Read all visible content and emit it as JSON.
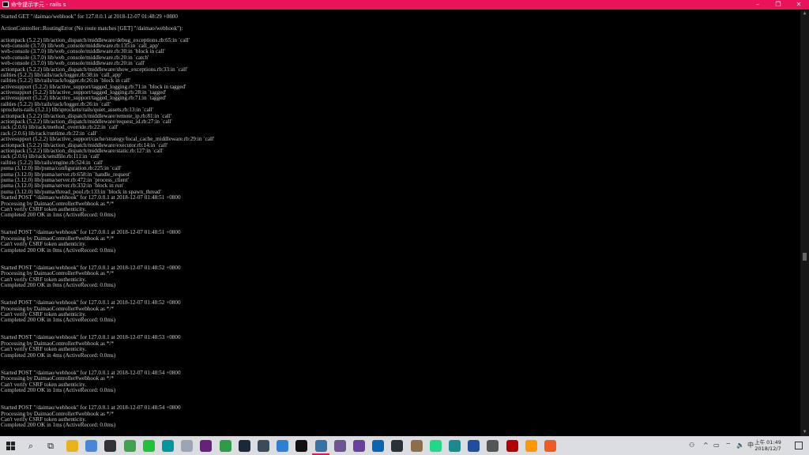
{
  "window": {
    "title": "命令提示字元 - rails  s",
    "minimize": "–",
    "maximize": "❐",
    "close": "✕"
  },
  "console_lines": [
    "Started GET \"/daimao/webhook\" for 127.0.0.1 at 2018-12-07 01:48:29 +0800",
    "",
    "ActionController::RoutingError (No route matches [GET] \"/daimao/webhook\"):",
    "",
    "actionpack (5.2.2) lib/action_dispatch/middleware/debug_exceptions.rb:65:in `call'",
    "web-console (3.7.0) lib/web_console/middleware.rb:135:in `call_app'",
    "web-console (3.7.0) lib/web_console/middleware.rb:30:in `block in call'",
    "web-console (3.7.0) lib/web_console/middleware.rb:20:in `catch'",
    "web-console (3.7.0) lib/web_console/middleware.rb:20:in `call'",
    "actionpack (5.2.2) lib/action_dispatch/middleware/show_exceptions.rb:33:in `call'",
    "railties (5.2.2) lib/rails/rack/logger.rb:38:in `call_app'",
    "railties (5.2.2) lib/rails/rack/logger.rb:26:in `block in call'",
    "activesupport (5.2.2) lib/active_support/tagged_logging.rb:71:in `block in tagged'",
    "activesupport (5.2.2) lib/active_support/tagged_logging.rb:28:in `tagged'",
    "activesupport (5.2.2) lib/active_support/tagged_logging.rb:71:in `tagged'",
    "railties (5.2.2) lib/rails/rack/logger.rb:26:in `call'",
    "sprockets-rails (3.2.1) lib/sprockets/rails/quiet_assets.rb:13:in `call'",
    "actionpack (5.2.2) lib/action_dispatch/middleware/remote_ip.rb:81:in `call'",
    "actionpack (5.2.2) lib/action_dispatch/middleware/request_id.rb:27:in `call'",
    "rack (2.0.6) lib/rack/method_override.rb:22:in `call'",
    "rack (2.0.6) lib/rack/runtime.rb:22:in `call'",
    "activesupport (5.2.2) lib/active_support/cache/strategy/local_cache_middleware.rb:29:in `call'",
    "actionpack (5.2.2) lib/action_dispatch/middleware/executor.rb:14:in `call'",
    "actionpack (5.2.2) lib/action_dispatch/middleware/static.rb:127:in `call'",
    "rack (2.0.6) lib/rack/sendfile.rb:111:in `call'",
    "railties (5.2.2) lib/rails/engine.rb:524:in `call'",
    "puma (3.12.0) lib/puma/configuration.rb:225:in `call'",
    "puma (3.12.0) lib/puma/server.rb:658:in `handle_request'",
    "puma (3.12.0) lib/puma/server.rb:472:in `process_client'",
    "puma (3.12.0) lib/puma/server.rb:332:in `block in run'",
    "puma (3.12.0) lib/puma/thread_pool.rb:133:in `block in spawn_thread'",
    "Started POST \"/daimao/webhook\" for 127.0.0.1 at 2018-12-07 01:48:51 +0800",
    "Processing by DaimaoController#webhook as */*",
    "Can't verify CSRF token authenticity.",
    "Completed 200 OK in 1ms (ActiveRecord: 0.0ms)",
    "",
    "",
    "Started POST \"/daimao/webhook\" for 127.0.0.1 at 2018-12-07 01:48:51 +0800",
    "Processing by DaimaoController#webhook as */*",
    "Can't verify CSRF token authenticity.",
    "Completed 200 OK in 0ms (ActiveRecord: 0.0ms)",
    "",
    "",
    "Started POST \"/daimao/webhook\" for 127.0.0.1 at 2018-12-07 01:48:52 +0800",
    "Processing by DaimaoController#webhook as */*",
    "Can't verify CSRF token authenticity.",
    "Completed 200 OK in 0ms (ActiveRecord: 0.0ms)",
    "",
    "",
    "Started POST \"/daimao/webhook\" for 127.0.0.1 at 2018-12-07 01:48:52 +0800",
    "Processing by DaimaoController#webhook as */*",
    "Can't verify CSRF token authenticity.",
    "Completed 200 OK in 1ms (ActiveRecord: 0.0ms)",
    "",
    "",
    "Started POST \"/daimao/webhook\" for 127.0.0.1 at 2018-12-07 01:48:53 +0800",
    "Processing by DaimaoController#webhook as */*",
    "Can't verify CSRF token authenticity.",
    "Completed 200 OK in 4ms (ActiveRecord: 0.0ms)",
    "",
    "",
    "Started POST \"/daimao/webhook\" for 127.0.0.1 at 2018-12-07 01:48:54 +0800",
    "Processing by DaimaoController#webhook as */*",
    "Can't verify CSRF token authenticity.",
    "Completed 200 OK in 1ms (ActiveRecord: 0.0ms)",
    "",
    "",
    "Started POST \"/daimao/webhook\" for 127.0.0.1 at 2018-12-07 01:48:54 +0800",
    "Processing by DaimaoController#webhook as */*",
    "Can't verify CSRF token authenticity.",
    "Completed 200 OK in 1ms (ActiveRecord: 0.0ms)"
  ],
  "taskbar": {
    "clock_time": "上午 01:49",
    "clock_date": "2018/12/7",
    "ime": "中",
    "icons": [
      {
        "name": "file-explorer",
        "color": "#e8b21b"
      },
      {
        "name": "store",
        "color": "#4a86d8"
      },
      {
        "name": "media",
        "color": "#333333"
      },
      {
        "name": "chrome",
        "color": "#3fa34d"
      },
      {
        "name": "line",
        "color": "#1fc239"
      },
      {
        "name": "arduino",
        "color": "#00979d"
      },
      {
        "name": "photos",
        "color": "#9aa6b2"
      },
      {
        "name": "visual-studio",
        "color": "#68217a"
      },
      {
        "name": "git",
        "color": "#2e9c46"
      },
      {
        "name": "steam",
        "color": "#1b2838"
      },
      {
        "name": "server",
        "color": "#3c4b5c"
      },
      {
        "name": "mail",
        "color": "#2f7fd0"
      },
      {
        "name": "terminal",
        "color": "#111111"
      },
      {
        "name": "python",
        "color": "#3572a5"
      },
      {
        "name": "github",
        "color": "#6e5494"
      },
      {
        "name": "vs-code",
        "color": "#6b3fa0"
      },
      {
        "name": "app-blue",
        "color": "#0a64b4"
      },
      {
        "name": "app-dark",
        "color": "#263238"
      },
      {
        "name": "gimp",
        "color": "#8a6f4a"
      },
      {
        "name": "pycharm",
        "color": "#21d789"
      },
      {
        "name": "app-teal",
        "color": "#1a8a8a"
      },
      {
        "name": "app-navy",
        "color": "#1e4f9c"
      },
      {
        "name": "app-gray",
        "color": "#555555"
      },
      {
        "name": "filezilla",
        "color": "#b30000"
      },
      {
        "name": "sublime",
        "color": "#ff9800"
      },
      {
        "name": "postman",
        "color": "#ef5b25"
      }
    ]
  },
  "colors": {
    "titlebar": "#e8135a",
    "console_text": "#c8c8c8",
    "console_bg": "#000000",
    "taskbar": "#dcdde0"
  }
}
